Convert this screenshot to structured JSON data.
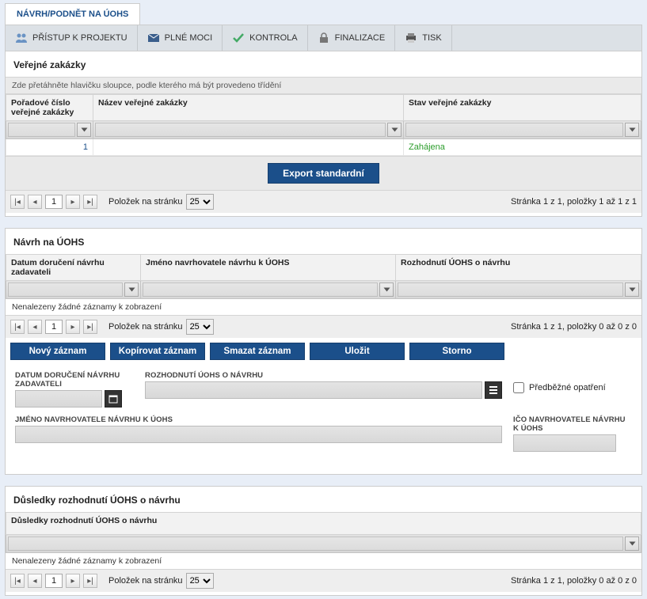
{
  "main_tab": "NÁVRH/PODNĚT NA ÚOHS",
  "toolbar": {
    "access": "PŘÍSTUP K PROJEKTU",
    "powers": "PLNÉ MOCI",
    "check": "KONTROLA",
    "finalize": "FINALIZACE",
    "print": "TISK"
  },
  "section1": {
    "title": "Veřejné zakázky",
    "group_hint": "Zde přetáhněte hlavičku sloupce, podle kterého má být provedeno třídění",
    "cols": {
      "seq": "Pořadové číslo veřejné zakázky",
      "name": "Název veřejné zakázky",
      "status": "Stav veřejné zakázky"
    },
    "row": {
      "seq": "1",
      "name": "",
      "status": "Zahájena"
    },
    "export_btn": "Export standardní"
  },
  "pager": {
    "page": "1",
    "per_page_label": "Položek na stránku",
    "per_page": "25",
    "info1": "Stránka 1 z 1, položky 1 až 1 z 1",
    "info0": "Stránka 1 z 1, položky 0 až 0 z 0"
  },
  "section2": {
    "title": "Návrh na ÚOHS",
    "cols": {
      "date": "Datum doručení návrhu zadavateli",
      "name": "Jméno navrhovatele návrhu k ÚOHS",
      "decision": "Rozhodnutí ÚOHS o návrhu"
    },
    "no_records": "Nenalezeny žádné záznamy k zobrazení",
    "actions": {
      "new": "Nový záznam",
      "copy": "Kopírovat záznam",
      "delete": "Smazat záznam",
      "save": "Uložit",
      "cancel": "Storno"
    },
    "form": {
      "date_label": "DATUM DORUČENÍ NÁVRHU ZADAVATELI",
      "decision_label": "ROZHODNUTÍ ÚOHS O NÁVRHU",
      "precaution_label": "Předběžné opatření",
      "name_label": "JMÉNO NAVRHOVATELE NÁVRHU K ÚOHS",
      "ico_label": "IČO NAVRHOVATELE NÁVRHU K ÚOHS"
    }
  },
  "section3": {
    "title": "Důsledky rozhodnutí ÚOHS o návrhu",
    "col": "Důsledky rozhodnutí ÚOHS o návrhu",
    "no_records": "Nenalezeny žádné záznamy k zobrazení"
  }
}
